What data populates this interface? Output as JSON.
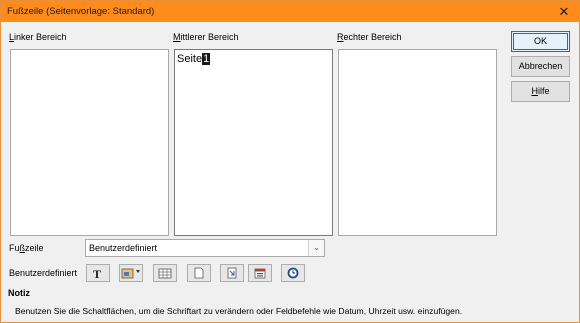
{
  "window": {
    "title": "Fußzeile (Seitenvorlage: Standard)",
    "close": "✕"
  },
  "areas": {
    "left": {
      "label_pre": "",
      "label_key": "L",
      "label_post": "inker Bereich",
      "content": ""
    },
    "center": {
      "label_pre": "",
      "label_key": "M",
      "label_post": "ittlerer Bereich",
      "content": "Seite",
      "field": "1"
    },
    "right": {
      "label_pre": "",
      "label_key": "R",
      "label_post": "echter Bereich",
      "content": ""
    }
  },
  "buttons": {
    "ok": "OK",
    "cancel": "Abbrechen",
    "help_key": "H",
    "help_rest": "ilfe"
  },
  "footer": {
    "label_pre": "Fu",
    "label_key": "ß",
    "label_post": "zeile",
    "selected": "Benutzerdefiniert"
  },
  "custom": {
    "label": "Benutzerdefiniert"
  },
  "toolbar": [
    "text-attributes-icon",
    "file-name-icon",
    "sheet-name-icon",
    "page-icon",
    "pages-icon",
    "date-icon",
    "time-icon"
  ],
  "note": {
    "heading": "Notiz",
    "text": "Benutzen Sie die Schaltflächen, um die Schriftart zu verändern oder Feldbefehle wie Datum, Uhrzeit usw. einzufügen."
  }
}
